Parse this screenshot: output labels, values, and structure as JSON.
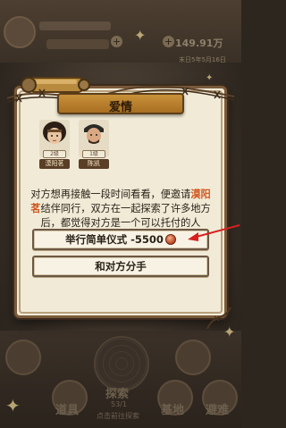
{
  "background": {
    "money": "149.91万",
    "date_text": "末日5年5月16日",
    "bottom_labels": {
      "props": "道具",
      "explore": "探索",
      "base": "基地",
      "shelter": "避难"
    },
    "explore_sub": "53/1",
    "explore_sub2": "点击前往探索"
  },
  "dialog": {
    "title": "爱情",
    "characters": [
      {
        "name": "漠阳茗",
        "level": "2级"
      },
      {
        "name": "陈凯",
        "level": "1级"
      }
    ],
    "story": {
      "part1": "对方想再接触一段时间看看，便邀请",
      "highlight": "漠阳茗",
      "part2": "结伴同行，双方在一起探索了许多地方后，都觉得对方是一个可以托付的人"
    },
    "choices": [
      {
        "label": "举行简单仪式 -5500"
      },
      {
        "label": "和对方分手"
      }
    ]
  },
  "colors": {
    "title_bar": "#c8913a",
    "highlight": "#d1581f",
    "arrow": "#d8201f",
    "dialog_bg": "#f1ead7"
  }
}
